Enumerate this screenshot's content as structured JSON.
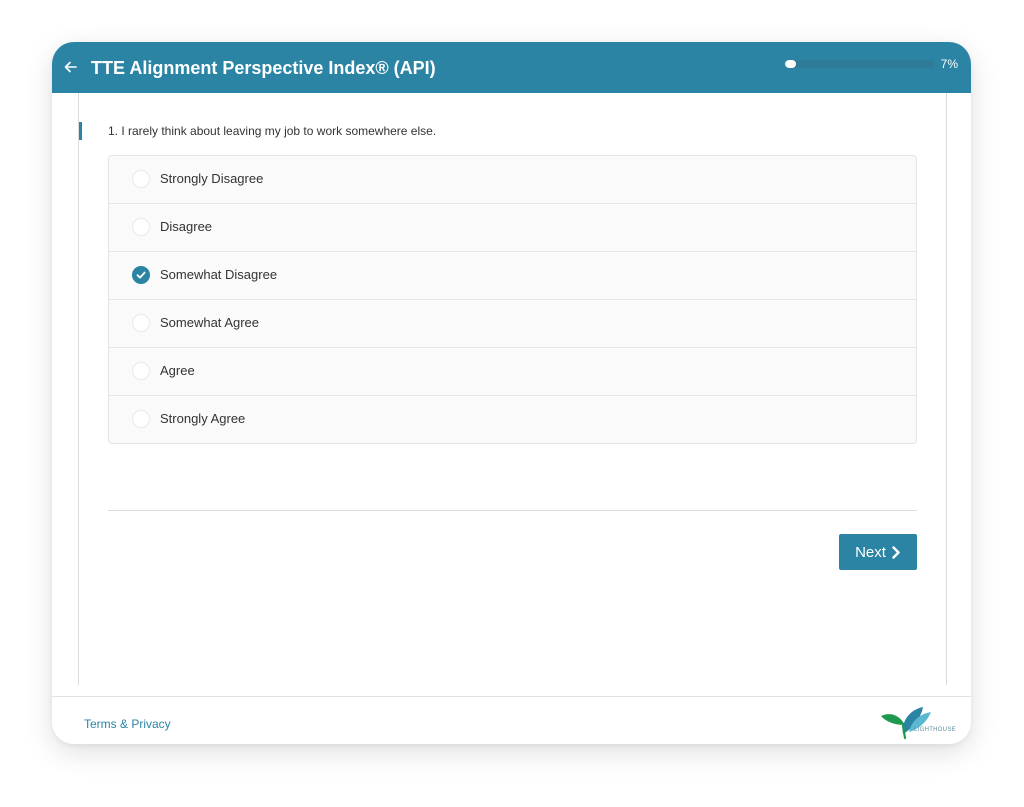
{
  "header": {
    "title": "TTE Alignment Perspective Index® (API)",
    "back_icon": "arrow-left-icon",
    "progress_fraction": 0.07,
    "progress_label": "7%"
  },
  "question": {
    "text": "1. I rarely think about leaving my job to work somewhere else.",
    "selected_index": 2,
    "options": [
      {
        "label": "Strongly Disagree"
      },
      {
        "label": "Disagree"
      },
      {
        "label": "Somewhat Disagree"
      },
      {
        "label": "Somewhat Agree"
      },
      {
        "label": "Agree"
      },
      {
        "label": "Strongly Agree"
      }
    ]
  },
  "actions": {
    "next_label": "Next",
    "next_icon": "chevron-right-icon"
  },
  "footer": {
    "terms_label": "Terms & Privacy",
    "logo_text": "LIGHTHOUSE"
  },
  "colors": {
    "primary": "#2b84a4",
    "progress_track": "#2f7c98",
    "text": "#333333",
    "option_bg": "#fafafa"
  }
}
